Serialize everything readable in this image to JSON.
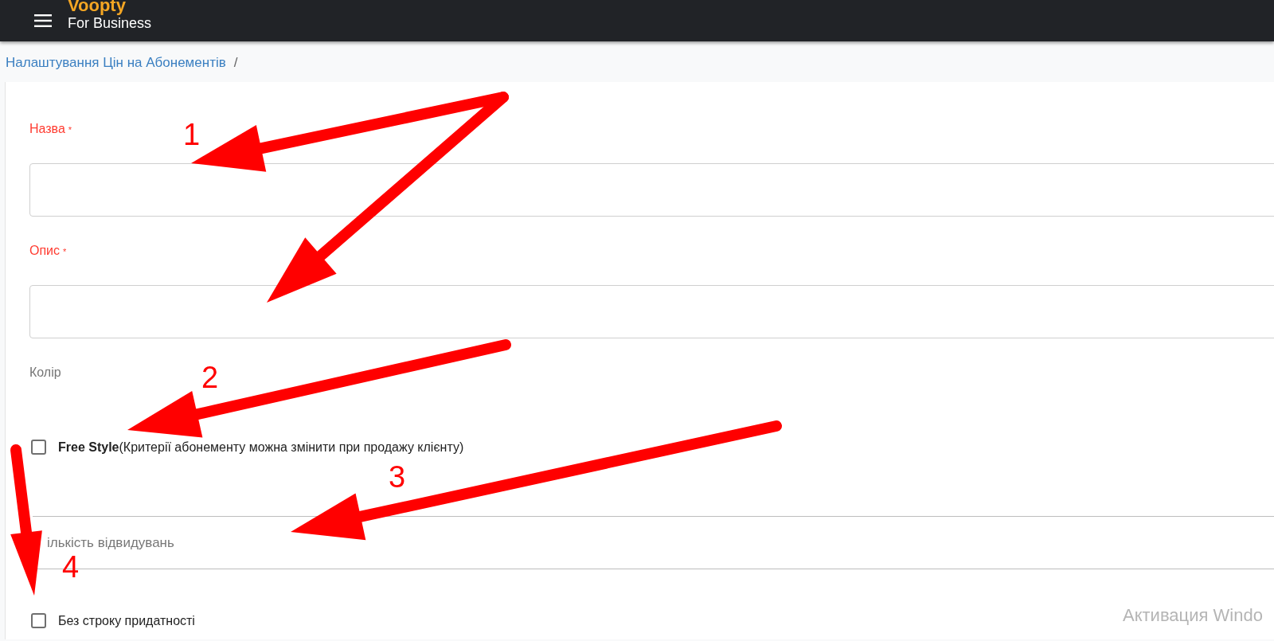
{
  "header": {
    "logo": "Voopty",
    "subtitle": "For Business"
  },
  "breadcrumb": {
    "items": [
      "Налаштування Цін на Абонементів"
    ],
    "separator": "/"
  },
  "form": {
    "fields": [
      {
        "kind": "text-field",
        "label": "Назва",
        "required_mark": "*",
        "invalid": true
      },
      {
        "kind": "text-field",
        "label": "Опис",
        "required_mark": "*",
        "invalid": true
      },
      {
        "kind": "color",
        "label": "Колір",
        "invalid": false
      },
      {
        "kind": "checkbox",
        "label": "**Free Style**(Критерії абонементу можна змінити при продажу клієнту)",
        "checked": false
      },
      {
        "kind": "line-field",
        "placeholder": "ількість відвидувань"
      },
      {
        "kind": "checkbox",
        "label": "Без строку придатності",
        "checked": false
      }
    ]
  },
  "annotations": [
    {
      "label": "1"
    },
    {
      "label": "2"
    },
    {
      "label": "3"
    },
    {
      "label": "4"
    }
  ],
  "os_overlay": {
    "title": "Активация Windo"
  }
}
